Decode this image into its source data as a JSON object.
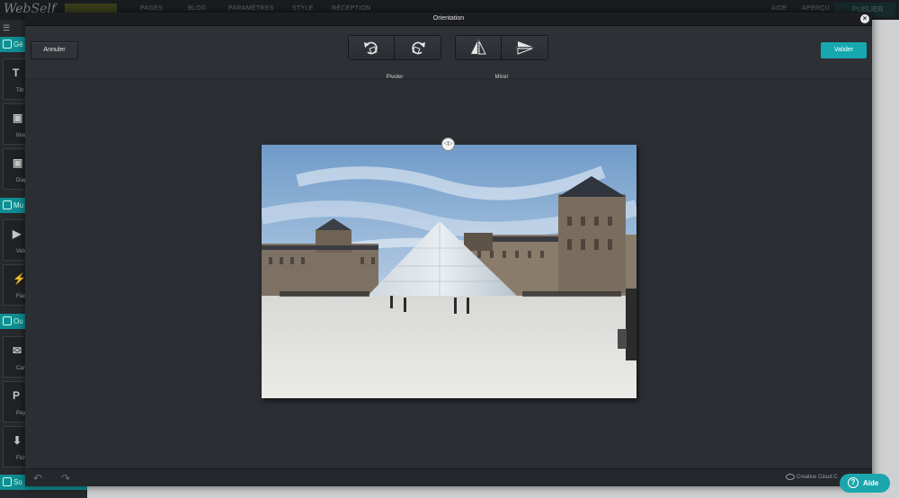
{
  "background_app": {
    "logo": "WebSelf",
    "nav": [
      "PAGES",
      "BLOG",
      "PARAMÈTRES",
      "STYLE",
      "RÉCEPTION"
    ],
    "right_links": [
      "AIDE",
      "APERÇU"
    ],
    "publish_label": "PUBLIER",
    "sidebar": {
      "sections": [
        "Gé",
        "Mu",
        "Ou",
        "So"
      ],
      "tiles": [
        {
          "symbol": "T",
          "label": "Titr"
        },
        {
          "symbol": "▣",
          "label": "Imag"
        },
        {
          "symbol": "▣",
          "label": "Diapo"
        },
        {
          "symbol": "▶",
          "label": "Vidé"
        },
        {
          "symbol": "⚡",
          "label": "Flas"
        },
        {
          "symbol": "✉",
          "label": "Cart"
        },
        {
          "symbol": "P",
          "label": "Payp"
        },
        {
          "symbol": "⬇",
          "label": "Fichi"
        }
      ]
    }
  },
  "modal": {
    "title": "Orientation",
    "close": "×",
    "cancel_label": "Annuler",
    "ok_label": "Valider",
    "rotate_label": "Pivoter",
    "mirror_label": "Miroir",
    "rotation_handle": "◁▷",
    "status": {
      "undo": "↶",
      "redo": "↷",
      "creative_cloud": "Creative Cloud C"
    }
  },
  "help": {
    "icon": "?",
    "label": "Aide"
  },
  "colors": {
    "accent": "#17a7ae",
    "modal_bg": "#2b2e33",
    "toolbar_bg": "#2d3035"
  },
  "icons": {
    "rotate_left": "rotate-left-icon",
    "rotate_right": "rotate-right-icon",
    "flip_horizontal": "flip-horizontal-icon",
    "flip_vertical": "flip-vertical-icon"
  }
}
